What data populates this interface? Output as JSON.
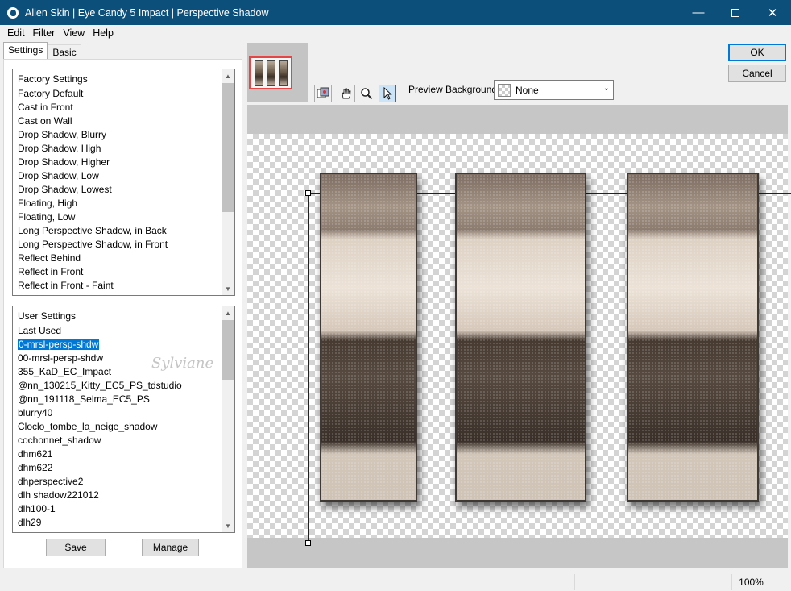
{
  "window": {
    "title": "Alien Skin | Eye Candy 5 Impact | Perspective Shadow"
  },
  "menu": [
    "Edit",
    "Filter",
    "View",
    "Help"
  ],
  "tabs": {
    "settings": "Settings",
    "basic": "Basic"
  },
  "factory": {
    "header": "Factory Settings",
    "items": [
      "Factory Default",
      "Cast in Front",
      "Cast on Wall",
      "Drop Shadow, Blurry",
      "Drop Shadow, High",
      "Drop Shadow, Higher",
      "Drop Shadow, Low",
      "Drop Shadow, Lowest",
      "Floating, High",
      "Floating, Low",
      "Long Perspective Shadow, in Back",
      "Long Perspective Shadow, in Front",
      "Reflect Behind",
      "Reflect in Front",
      "Reflect in Front - Faint"
    ]
  },
  "user": {
    "header": "User Settings",
    "items": [
      "Last Used",
      "0-mrsl-persp-shdw",
      "00-mrsl-persp-shdw",
      "355_KaD_EC_Impact",
      "@nn_130215_Kitty_EC5_PS_tdstudio",
      "@nn_191118_Selma_EC5_PS",
      "blurry40",
      "Cloclo_tombe_la_neige_shadow",
      "cochonnet_shadow",
      "dhm621",
      "dhm622",
      "dhperspective2",
      "dlh shadow221012",
      "dlh100-1",
      "dlh29"
    ],
    "selected_index": 1
  },
  "buttons": {
    "save": "Save",
    "manage": "Manage",
    "ok": "OK",
    "cancel": "Cancel"
  },
  "preview": {
    "background_label": "Preview Background:",
    "background_value": "None"
  },
  "watermark": "Sylviane",
  "status": {
    "zoom": "100%"
  },
  "icons": [
    "app-logo-icon",
    "minimize-icon",
    "maximize-icon",
    "close-icon",
    "preview-toggle-icon",
    "hand-tool-icon",
    "zoom-tool-icon",
    "select-tool-icon",
    "dropdown-arrow-icon"
  ]
}
